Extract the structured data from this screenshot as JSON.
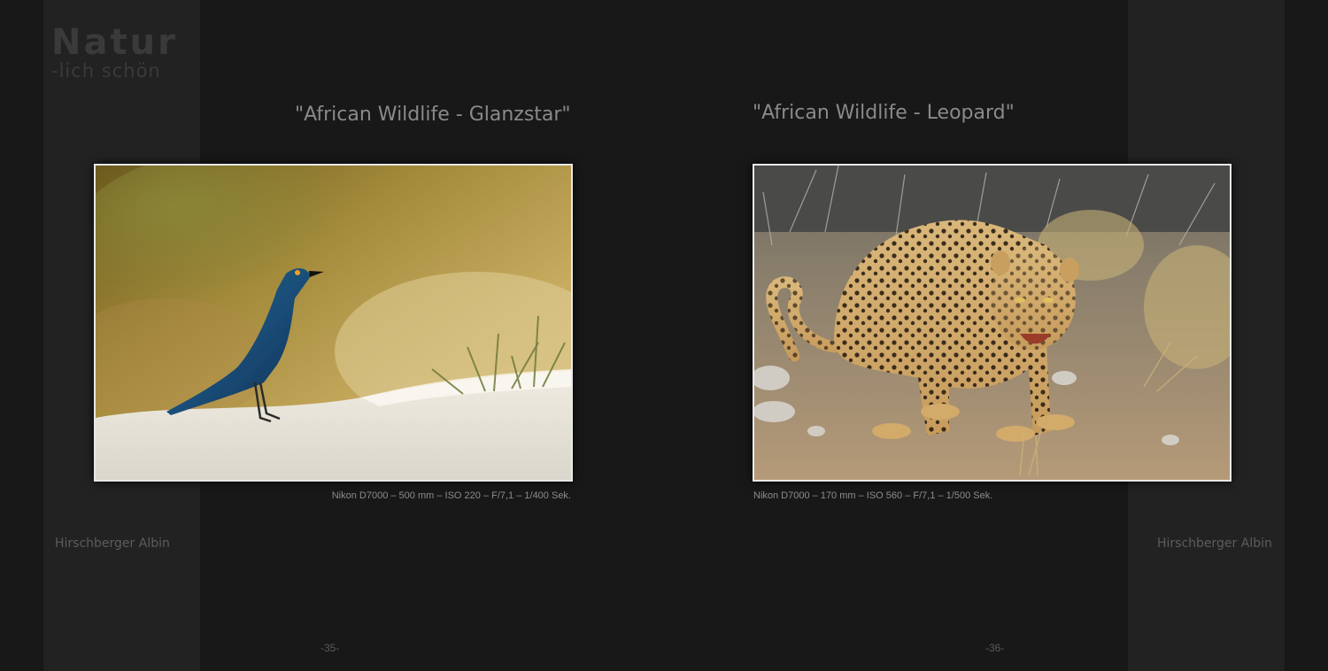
{
  "logo": {
    "line1": "Natur",
    "line2": "-lich schön"
  },
  "left_page": {
    "title": "\"African Wildlife - Glanzstar\"",
    "photo_subject": "glossy starling on sand",
    "caption": "Nikon D7000 – 500 mm – ISO 220 – F/7,1 – 1/400 Sek.",
    "author": "Hirschberger Albin",
    "page_number": "-35-"
  },
  "right_page": {
    "title": "\"African Wildlife - Leopard\"",
    "photo_subject": "leopard walking on dry ground",
    "caption": "Nikon D7000 – 170 mm – ISO 560 – F/7,1 – 1/500 Sek.",
    "author": "Hirschberger Albin",
    "page_number": "-36-"
  },
  "colors": {
    "background": "#181818",
    "side_strip": "#222222",
    "photo_border": "#e8e8e8",
    "title_text": "#8a8a8a"
  }
}
